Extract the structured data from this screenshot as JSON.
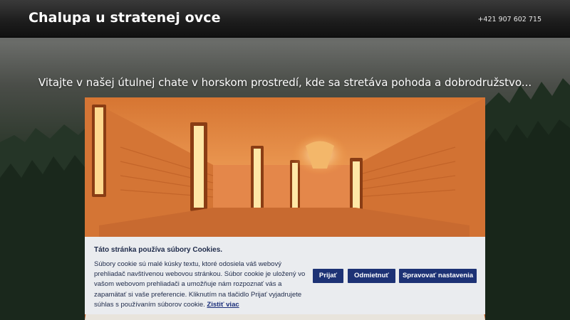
{
  "header": {
    "title": "Chalupa u stratenej ovce",
    "phone": "+421 907 602 715"
  },
  "hero": {
    "welcome": "Vitajte v našej útulnej chate v horskom prostredí, kde sa stretáva pohoda a dobrodružstvo..."
  },
  "cookie_banner": {
    "title": "Táto stránka používa súbory Cookies.",
    "text": "Súbory cookie sú malé kúsky textu, ktoré odosiela váš webový prehliadač navštívenou webovou stránkou. Súbor cookie je uložený vo vašom webovom prehliadači a umožňuje nám rozpoznať vás a zapamätať si vaše preferencie. Kliknutím na tlačidlo Prijať vyjadrujete súhlas s používaním súborov cookie.",
    "more_link": "Zistiť viac",
    "accept_label": "Prijať",
    "reject_label": "Odmietnuť",
    "settings_label": "Spravovať nastavenia"
  },
  "colors": {
    "header_bg": "#1c1c1c",
    "button_bg": "#1d3275",
    "banner_bg": "#eaecef",
    "sauna_wood": "#d97a35"
  }
}
